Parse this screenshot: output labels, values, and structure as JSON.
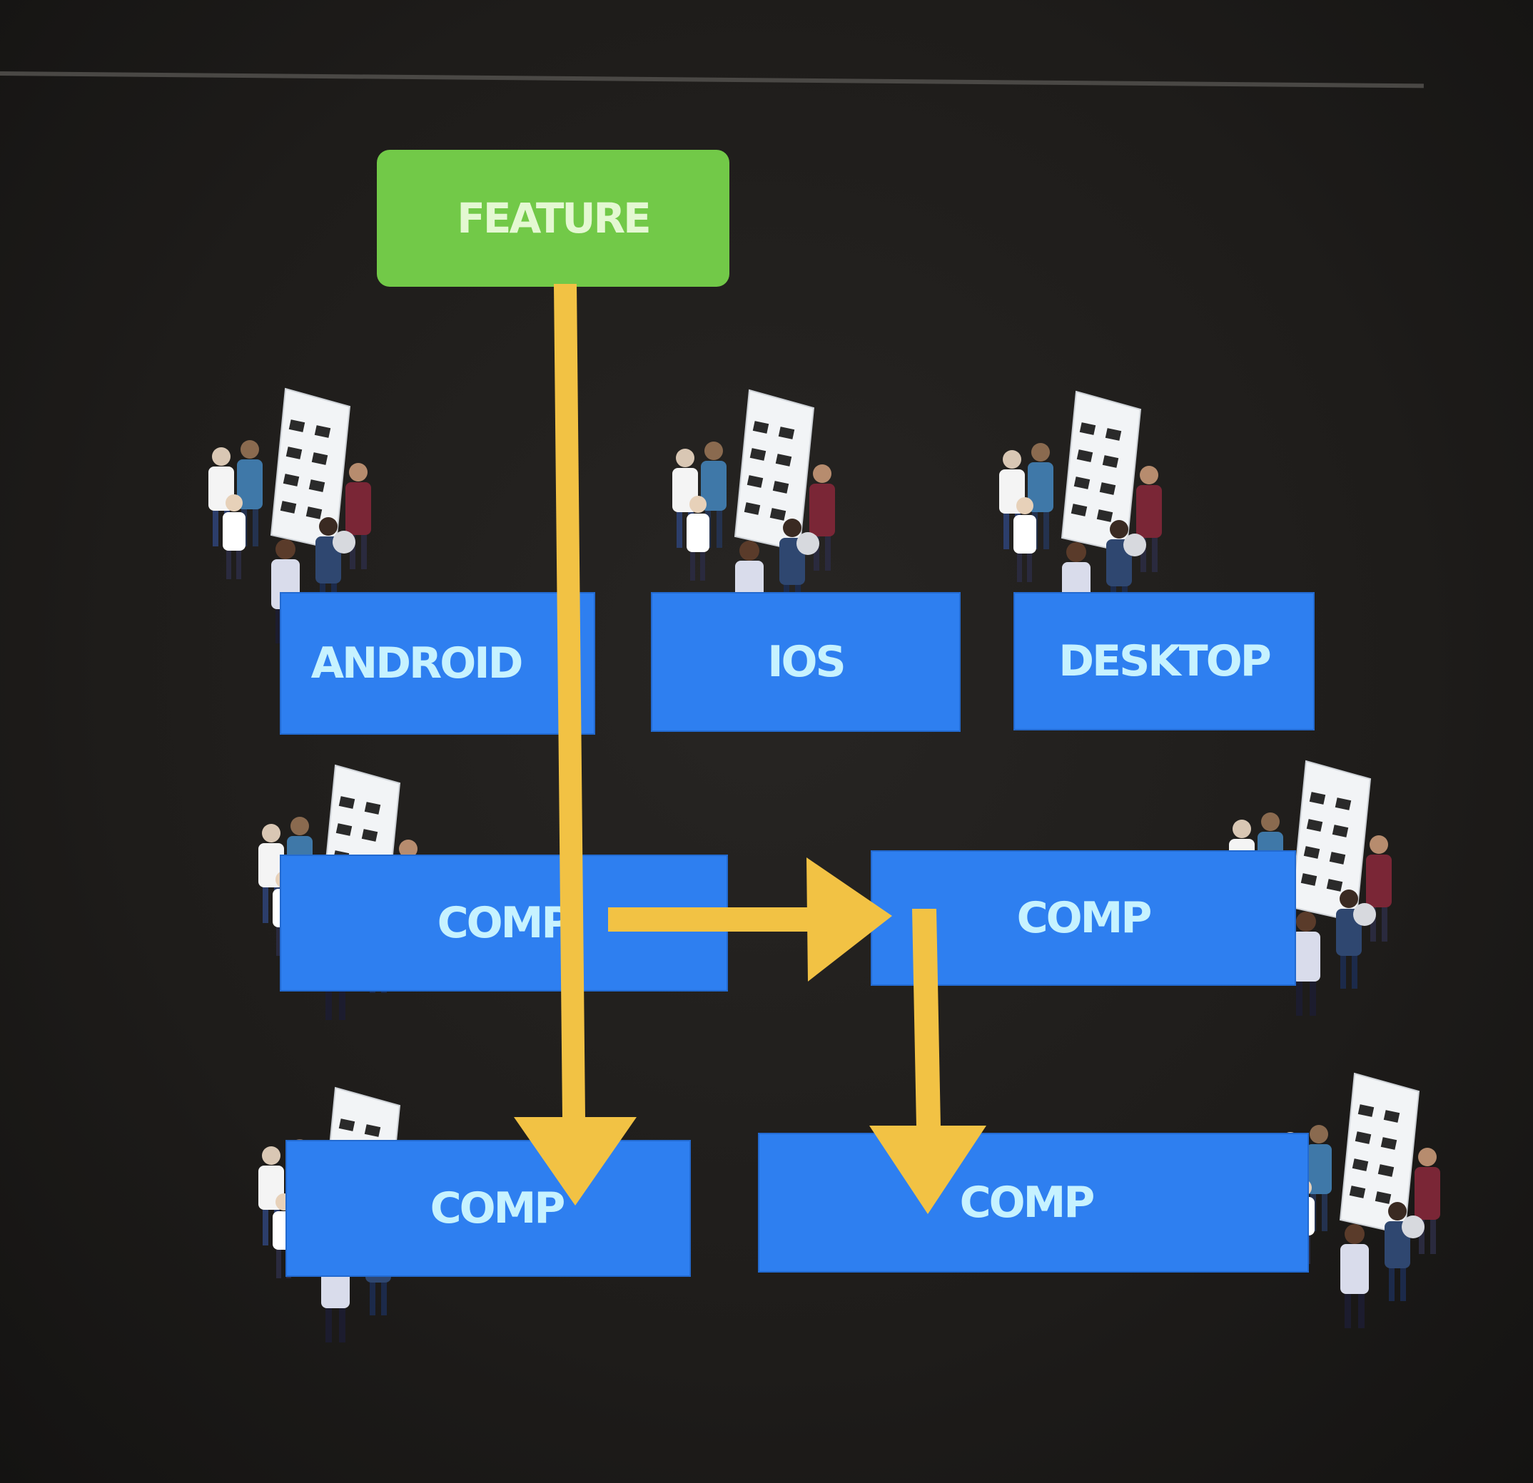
{
  "diagram": {
    "feature": {
      "label": "FEATURE"
    },
    "platform_teams": [
      {
        "label": "ANDROID"
      },
      {
        "label": "IOS"
      },
      {
        "label": "DESKTOP"
      }
    ],
    "component_teams": [
      {
        "label": "COMP"
      },
      {
        "label": "COMP"
      },
      {
        "label": "COMP"
      },
      {
        "label": "COMP"
      }
    ]
  },
  "colors": {
    "background": "#1e1c1a",
    "feature_box": "#72c948",
    "team_box": "#2e7ff0",
    "label_text": "#c6f2ff",
    "arrow": "#f2c244",
    "divider": "#4a4845"
  },
  "icons": [
    "team-people-icon",
    "kanban-board-icon",
    "arrow-down-icon",
    "arrow-right-icon"
  ]
}
